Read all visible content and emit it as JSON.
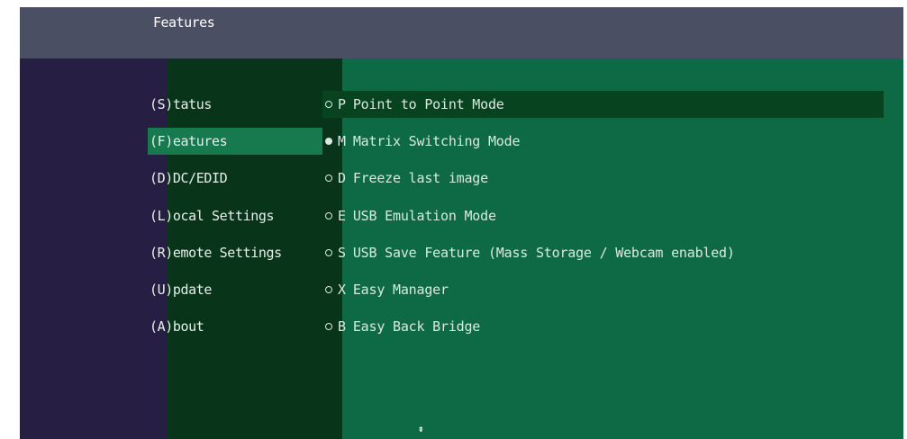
{
  "header": {
    "title": "Features"
  },
  "menu": [
    {
      "label": "(S)tatus",
      "selected": false
    },
    {
      "label": "(F)eatures",
      "selected": true
    },
    {
      "label": "(D)DC/EDID",
      "selected": false
    },
    {
      "label": "(L)ocal Settings",
      "selected": false
    },
    {
      "label": "(R)emote Settings",
      "selected": false
    },
    {
      "label": "(U)pdate",
      "selected": false
    },
    {
      "label": "(A)bout",
      "selected": false
    }
  ],
  "options": [
    {
      "key": "P",
      "label": "Point to Point Mode",
      "checked": false,
      "highlighted": true
    },
    {
      "key": "M",
      "label": "Matrix Switching Mode",
      "checked": true,
      "highlighted": false
    },
    {
      "key": "D",
      "label": "Freeze last image",
      "checked": false,
      "highlighted": false
    },
    {
      "key": "E",
      "label": "USB Emulation Mode",
      "checked": false,
      "highlighted": false
    },
    {
      "key": "S",
      "label": "USB Save Feature (Mass Storage / Webcam enabled)",
      "checked": false,
      "highlighted": false
    },
    {
      "key": "X",
      "label": "Easy Manager",
      "checked": false,
      "highlighted": false
    },
    {
      "key": "B",
      "label": "Easy Back Bridge",
      "checked": false,
      "highlighted": false
    }
  ],
  "cursor": "⇟",
  "colors": {
    "header": "#4b4f64",
    "left_pane": "#261f43",
    "menu_pane": "#08341a",
    "menu_selected": "#17794e",
    "content_pane": "#0e6a45",
    "option_highlight": "#07431f"
  }
}
